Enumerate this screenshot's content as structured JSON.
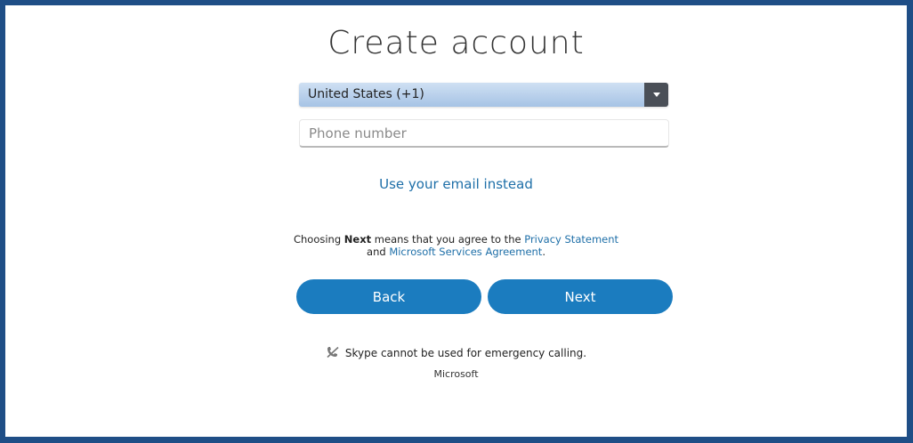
{
  "title": "Create account",
  "country_select": {
    "value": "United States (+1)"
  },
  "phone": {
    "placeholder": "Phone number",
    "value": ""
  },
  "email_link": "Use your email instead",
  "agreement": {
    "prefix": "Choosing ",
    "bold": "Next",
    "middle": " means that you agree to the ",
    "privacy_link": "Privacy Statement",
    "and": "and ",
    "services_link": "Microsoft Services Agreement",
    "suffix": "."
  },
  "buttons": {
    "back": "Back",
    "next": "Next"
  },
  "emergency_notice": "Skype cannot be used for emergency calling.",
  "brand": "Microsoft",
  "colors": {
    "accent": "#1b7cbf",
    "link": "#1e6fa8",
    "frame": "#1f4e86"
  },
  "icons": {
    "emergency": "no-phone-icon",
    "select": "chevron-down-icon"
  }
}
